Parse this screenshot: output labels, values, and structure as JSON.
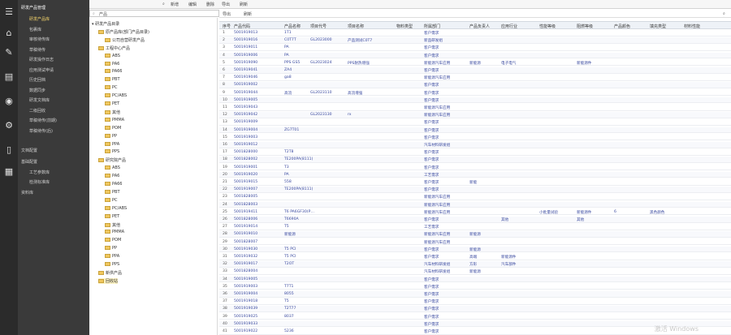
{
  "menu": {
    "section_title": "研发产品管理",
    "items": [
      {
        "label": "研发产品库",
        "highlight": true
      },
      {
        "label": "包裹库",
        "highlight": false
      },
      {
        "label": "审核待传库",
        "highlight": false
      },
      {
        "label": "草稿待传",
        "highlight": false
      },
      {
        "label": "研发操作日志",
        "highlight": false
      },
      {
        "label": "应用测试申请",
        "highlight": false
      },
      {
        "label": "历史回档",
        "highlight": false
      },
      {
        "label": "数据同步",
        "highlight": false
      },
      {
        "label": "研发文档库",
        "highlight": false
      },
      {
        "label": "二级回收",
        "highlight": false
      },
      {
        "label": "草稿待传(前期)",
        "highlight": false
      },
      {
        "label": "草稿待传(后)",
        "highlight": false
      }
    ],
    "section2": "文档配置",
    "section3": "基础配置",
    "sub3": [
      "工艺参数库",
      "检测标准库"
    ],
    "section4": "资料库"
  },
  "toolbar": {
    "new": "新增",
    "edit": "编辑",
    "delete": "删除",
    "export": "导出",
    "refresh": "刷新"
  },
  "search": {
    "placeholder": "产品"
  },
  "grid_toolbar": {
    "add": "导出",
    "refresh": "刷新"
  },
  "tree": [
    {
      "label": "研发产品目录",
      "level": 0,
      "folder": false,
      "selected": false
    },
    {
      "label": "原产品库(部门产品目录)",
      "level": 1,
      "folder": true,
      "selected": false
    },
    {
      "label": "公司自营研发产品",
      "level": 2,
      "folder": true,
      "selected": false
    },
    {
      "label": "工程中心产品",
      "level": 1,
      "folder": true,
      "selected": false
    },
    {
      "label": "ABS",
      "level": 2,
      "folder": true,
      "selected": false
    },
    {
      "label": "PA6",
      "level": 2,
      "folder": true,
      "selected": false
    },
    {
      "label": "PA66",
      "level": 2,
      "folder": true,
      "selected": false
    },
    {
      "label": "PBT",
      "level": 2,
      "folder": true,
      "selected": false
    },
    {
      "label": "PC",
      "level": 2,
      "folder": true,
      "selected": false
    },
    {
      "label": "PC/ABS",
      "level": 2,
      "folder": true,
      "selected": false
    },
    {
      "label": "PET",
      "level": 2,
      "folder": true,
      "selected": false
    },
    {
      "label": "其他",
      "level": 2,
      "folder": true,
      "selected": false
    },
    {
      "label": "PMMA",
      "level": 2,
      "folder": true,
      "selected": false
    },
    {
      "label": "POM",
      "level": 2,
      "folder": true,
      "selected": false
    },
    {
      "label": "PP",
      "level": 2,
      "folder": true,
      "selected": false
    },
    {
      "label": "PPA",
      "level": 2,
      "folder": true,
      "selected": false
    },
    {
      "label": "PPS",
      "level": 2,
      "folder": true,
      "selected": false
    },
    {
      "label": "研究院产品",
      "level": 1,
      "folder": true,
      "selected": false
    },
    {
      "label": "ABS",
      "level": 2,
      "folder": true,
      "selected": false
    },
    {
      "label": "PA6",
      "level": 2,
      "folder": true,
      "selected": false
    },
    {
      "label": "PA66",
      "level": 2,
      "folder": true,
      "selected": false
    },
    {
      "label": "PBT",
      "level": 2,
      "folder": true,
      "selected": false
    },
    {
      "label": "PC",
      "level": 2,
      "folder": true,
      "selected": false
    },
    {
      "label": "PC/ABS",
      "level": 2,
      "folder": true,
      "selected": false
    },
    {
      "label": "PET",
      "level": 2,
      "folder": true,
      "selected": false
    },
    {
      "label": "其他",
      "level": 2,
      "folder": true,
      "selected": false
    },
    {
      "label": "PMMA",
      "level": 2,
      "folder": true,
      "selected": false
    },
    {
      "label": "POM",
      "level": 2,
      "folder": true,
      "selected": false
    },
    {
      "label": "PP",
      "level": 2,
      "folder": true,
      "selected": false
    },
    {
      "label": "PPA",
      "level": 2,
      "folder": true,
      "selected": false
    },
    {
      "label": "PPS",
      "level": 2,
      "folder": true,
      "selected": false
    },
    {
      "label": "新供产品",
      "level": 1,
      "folder": true,
      "selected": false
    },
    {
      "label": "回收站",
      "level": 1,
      "folder": true,
      "selected": true
    }
  ],
  "columns": [
    "序号",
    "产品代码",
    "产品名称",
    "项目代号",
    "项目名称",
    "物料类型",
    "所属部门",
    "产品负责人",
    "应用行业",
    "性能等级",
    "阻燃等级",
    "产品颜色",
    "填充类型",
    "材料性能"
  ],
  "rows": [
    [
      "1",
      "5001919013",
      "1T1",
      "",
      "",
      "",
      "客户需求",
      "",
      "",
      "",
      "",
      "",
      "",
      ""
    ],
    [
      "2",
      "5001919016",
      "C0T7T",
      "GL2023000",
      "产品测试C0T7",
      "",
      "新品研发组",
      "",
      "",
      "",
      "",
      "",
      "",
      ""
    ],
    [
      "3",
      "5001919011",
      "PA",
      "",
      "",
      "",
      "客户需求",
      "",
      "",
      "",
      "",
      "",
      "",
      ""
    ],
    [
      "4",
      "5001919006",
      "PA",
      "",
      "",
      "",
      "客户需求",
      "",
      "",
      "",
      "",
      "",
      "",
      ""
    ],
    [
      "5",
      "5001919090",
      "PPS GS5",
      "GL2023024",
      "PPS耐热增强",
      "",
      "新能源汽车应用",
      "新能源",
      "电子电气",
      "",
      "新能源件",
      "",
      "",
      ""
    ],
    [
      "6",
      "5001919041",
      "ZA4",
      "",
      "",
      "",
      "客户需求",
      "",
      "",
      "",
      "",
      "",
      "",
      ""
    ],
    [
      "7",
      "5001919046",
      "ga8",
      "",
      "",
      "",
      "新能源汽车应用",
      "",
      "",
      "",
      "",
      "",
      "",
      ""
    ],
    [
      "8",
      "5001919002",
      "",
      "",
      "",
      "",
      "客户需求",
      "",
      "",
      "",
      "",
      "",
      "",
      ""
    ],
    [
      "9",
      "5001919044",
      "高流",
      "GL2023110",
      "高流增强",
      "",
      "客户需求",
      "",
      "",
      "",
      "",
      "",
      "",
      ""
    ],
    [
      "10",
      "5001919005",
      "",
      "",
      "",
      "",
      "客户需求",
      "",
      "",
      "",
      "",
      "",
      "",
      ""
    ],
    [
      "11",
      "5001919043",
      "",
      "",
      "",
      "",
      "新能源汽车应用",
      "",
      "",
      "",
      "",
      "",
      "",
      ""
    ],
    [
      "12",
      "5001919042",
      "",
      "GL2023130",
      "rx",
      "",
      "新能源汽车应用",
      "",
      "",
      "",
      "",
      "",
      "",
      ""
    ],
    [
      "13",
      "5001919009",
      "",
      "",
      "",
      "",
      "客户需求",
      "",
      "",
      "",
      "",
      "",
      "",
      ""
    ],
    [
      "14",
      "5001919004",
      "ZG7T01",
      "",
      "",
      "",
      "客户需求",
      "",
      "",
      "",
      "",
      "",
      "",
      ""
    ],
    [
      "15",
      "5001919003",
      "",
      "",
      "",
      "",
      "客户需求",
      "",
      "",
      "",
      "",
      "",
      "",
      ""
    ],
    [
      "16",
      "5001919012",
      "",
      "",
      "",
      "",
      "汽车材料研发组",
      "",
      "",
      "",
      "",
      "",
      "",
      ""
    ],
    [
      "17",
      "5001828000",
      "T2T8",
      "",
      "",
      "",
      "客户需求",
      "",
      "",
      "",
      "",
      "",
      "",
      ""
    ],
    [
      "18",
      "5001828002",
      "TE200PA(8111)",
      "",
      "",
      "",
      "客户需求",
      "",
      "",
      "",
      "",
      "",
      "",
      ""
    ],
    [
      "19",
      "5001919001",
      "T3",
      "",
      "",
      "",
      "客户需求",
      "",
      "",
      "",
      "",
      "",
      "",
      ""
    ],
    [
      "20",
      "5001919020",
      "PA",
      "",
      "",
      "",
      "工艺需求",
      "",
      "",
      "",
      "",
      "",
      "",
      ""
    ],
    [
      "21",
      "5001919015",
      "558",
      "",
      "",
      "",
      "客户需求",
      "新能",
      "",
      "",
      "",
      "",
      "",
      ""
    ],
    [
      "22",
      "5001919007",
      "TE200PA(8111)",
      "",
      "",
      "",
      "客户需求",
      "",
      "",
      "",
      "",
      "",
      "",
      ""
    ],
    [
      "23",
      "5001828005",
      "",
      "",
      "",
      "",
      "新能源汽车应用",
      "",
      "",
      "",
      "",
      "",
      "",
      ""
    ],
    [
      "24",
      "5001828003",
      "",
      "",
      "",
      "",
      "新能源汽车应用",
      "",
      "",
      "",
      "",
      "",
      "",
      ""
    ],
    [
      "25",
      "5001919411",
      "T6 PA6GF30(P…",
      "",
      "",
      "",
      "新能源汽车应用",
      "",
      "",
      "小批量试验",
      "新能源件",
      "6",
      "黑色颜色",
      ""
    ],
    [
      "26",
      "5001828006",
      "T6690A",
      "",
      "",
      "",
      "客户需求",
      "",
      "其他",
      "",
      "其他",
      "",
      "",
      ""
    ],
    [
      "27",
      "5001919014",
      "T5",
      "",
      "",
      "",
      "工艺需求",
      "",
      "",
      "",
      "",
      "",
      "",
      ""
    ],
    [
      "28",
      "5001919010",
      "新能源",
      "",
      "",
      "",
      "新能源汽车应用",
      "新能源",
      "",
      "",
      "",
      "",
      "",
      ""
    ],
    [
      "29",
      "5001828007",
      "",
      "",
      "",
      "",
      "新能源汽车应用",
      "",
      "",
      "",
      "",
      "",
      "",
      ""
    ],
    [
      "30",
      "5001919030",
      "T5 PCI",
      "",
      "",
      "",
      "客户需求",
      "新能源",
      "",
      "",
      "",
      "",
      "",
      ""
    ],
    [
      "31",
      "5001919032",
      "T5 PCI",
      "",
      "",
      "",
      "客户需求",
      "高端",
      "新能源件",
      "",
      "",
      "",
      "",
      ""
    ],
    [
      "32",
      "5001919017",
      "T2OT",
      "",
      "",
      "",
      "汽车材料研发组",
      "方形",
      "汽车部件",
      "",
      "",
      "",
      "",
      ""
    ],
    [
      "33",
      "5001828004",
      "",
      "",
      "",
      "",
      "汽车材料研发组",
      "新能源",
      "",
      "",
      "",
      "",
      "",
      ""
    ],
    [
      "34",
      "5001919005",
      "",
      "",
      "",
      "",
      "客户需求",
      "",
      "",
      "",
      "",
      "",
      "",
      ""
    ],
    [
      "35",
      "5001919003",
      "T7T1",
      "",
      "",
      "",
      "客户需求",
      "",
      "",
      "",
      "",
      "",
      "",
      ""
    ],
    [
      "36",
      "5001919004",
      "8055",
      "",
      "",
      "",
      "客户需求",
      "",
      "",
      "",
      "",
      "",
      "",
      ""
    ],
    [
      "37",
      "5001919018",
      "T5",
      "",
      "",
      "",
      "客户需求",
      "",
      "",
      "",
      "",
      "",
      "",
      ""
    ],
    [
      "38",
      "5001919039",
      "T2T77",
      "",
      "",
      "",
      "客户需求",
      "",
      "",
      "",
      "",
      "",
      "",
      ""
    ],
    [
      "39",
      "5001919025",
      "8037",
      "",
      "",
      "",
      "客户需求",
      "",
      "",
      "",
      "",
      "",
      "",
      ""
    ],
    [
      "40",
      "5001919033",
      "",
      "",
      "",
      "",
      "客户需求",
      "",
      "",
      "",
      "",
      "",
      "",
      ""
    ],
    [
      "41",
      "5001919022",
      "5236",
      "",
      "",
      "",
      "客户需求",
      "",
      "",
      "",
      "",
      "",
      "",
      ""
    ]
  ],
  "watermark": "激活 Windows"
}
